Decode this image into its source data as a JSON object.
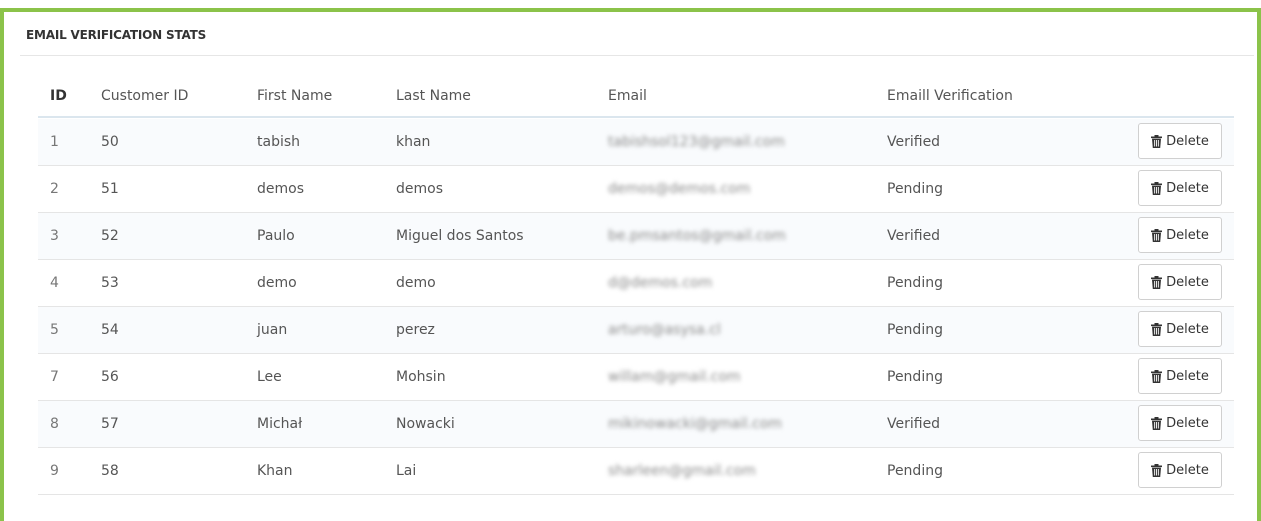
{
  "panel": {
    "title": "EMAIL VERIFICATION STATS"
  },
  "table": {
    "headers": [
      "ID",
      "Customer ID",
      "First Name",
      "Last Name",
      "Email",
      "Emaill Verification"
    ],
    "delete_label": "Delete",
    "rows": [
      {
        "id": "1",
        "customer_id": "50",
        "first_name": "tabish",
        "last_name": "khan",
        "email": "tabishsol123@gmail.com",
        "verification": "Verified"
      },
      {
        "id": "2",
        "customer_id": "51",
        "first_name": "demos",
        "last_name": "demos",
        "email": "demos@demos.com",
        "verification": "Pending"
      },
      {
        "id": "3",
        "customer_id": "52",
        "first_name": "Paulo",
        "last_name": "Miguel dos Santos",
        "email": "be.pmsantos@gmail.com",
        "verification": "Verified"
      },
      {
        "id": "4",
        "customer_id": "53",
        "first_name": "demo",
        "last_name": "demo",
        "email": "d@demos.com",
        "verification": "Pending"
      },
      {
        "id": "5",
        "customer_id": "54",
        "first_name": "juan",
        "last_name": "perez",
        "email": "arturo@asysa.cl",
        "verification": "Pending"
      },
      {
        "id": "7",
        "customer_id": "56",
        "first_name": "Lee",
        "last_name": "Mohsin",
        "email": "willam@gmail.com",
        "verification": "Pending"
      },
      {
        "id": "8",
        "customer_id": "57",
        "first_name": "Michał",
        "last_name": "Nowacki",
        "email": "mikinowacki@gmail.com",
        "verification": "Verified"
      },
      {
        "id": "9",
        "customer_id": "58",
        "first_name": "Khan",
        "last_name": "Lai",
        "email": "sharleen@gmail.com",
        "verification": "Pending"
      }
    ]
  },
  "colors": {
    "frame_accent": "#8bc34a"
  },
  "icons": {
    "delete": "trash-icon"
  }
}
